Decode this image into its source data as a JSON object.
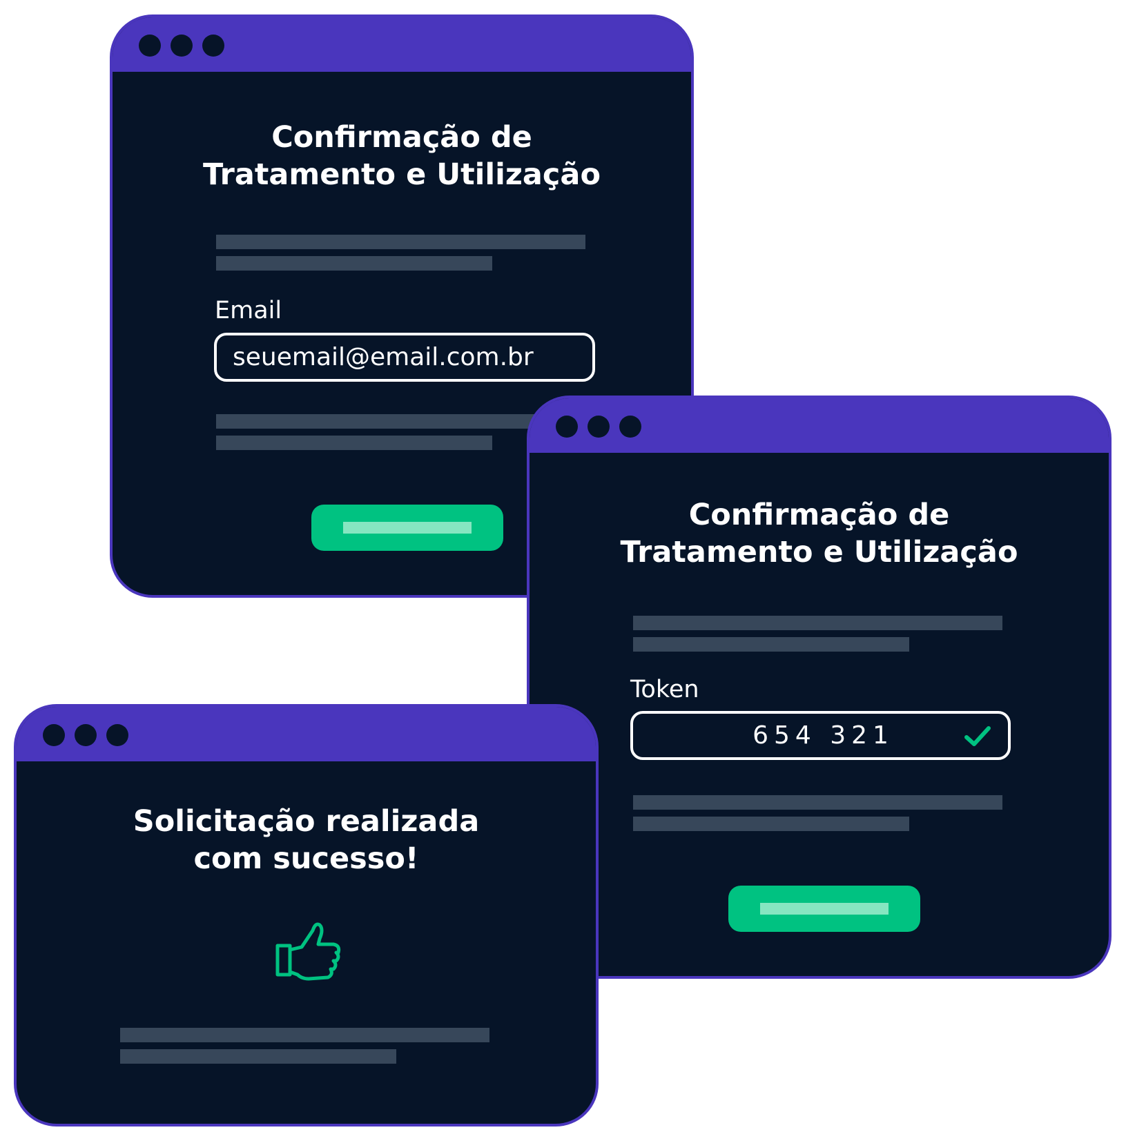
{
  "windows": {
    "email": {
      "title_line1": "Confirmação de",
      "title_line2": "Tratamento e Utilização",
      "field_label": "Email",
      "field_value": "seuemail@email.com.br"
    },
    "token": {
      "title_line1": "Confirmação de",
      "title_line2": "Tratamento e Utilização",
      "field_label": "Token",
      "field_value": "654 321",
      "field_status_icon": "checkmark-icon"
    },
    "success": {
      "title_line1": "Solicitação realizada",
      "title_line2": "com sucesso!",
      "icon": "thumbs-up-icon"
    }
  },
  "colors": {
    "window_frame": "#4a36bd",
    "window_body": "#061428",
    "placeholder_bar": "#37475a",
    "accent_green": "#00c281",
    "button_line": "#86e6c1",
    "text": "#ffffff"
  }
}
